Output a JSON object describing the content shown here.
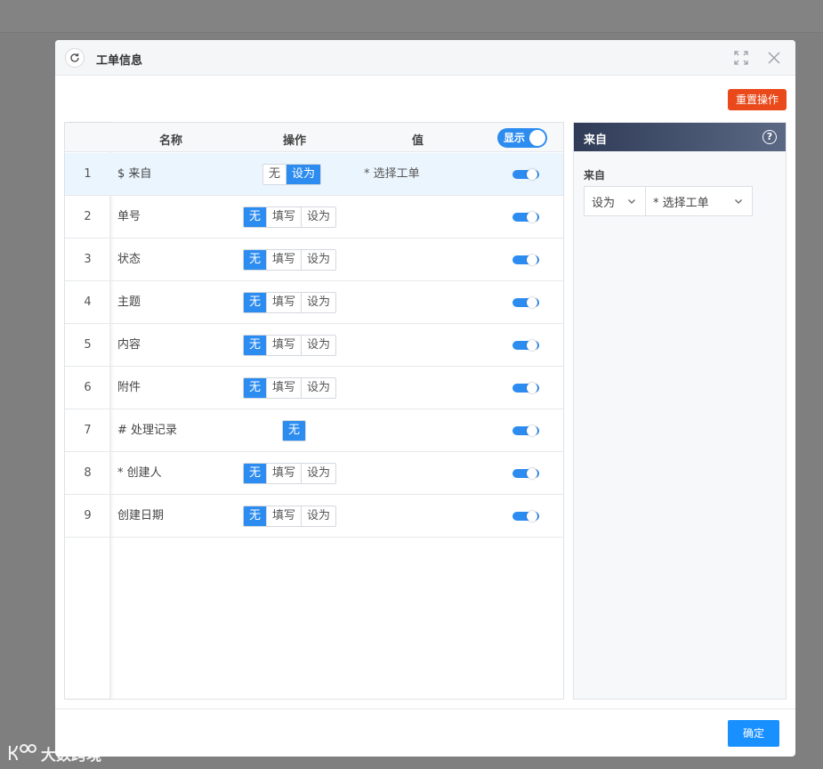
{
  "dialog": {
    "title": "工单信息",
    "reset_label": "重置操作",
    "ok_label": "确定"
  },
  "table": {
    "headers": {
      "name": "名称",
      "action": "操作",
      "value": "值"
    },
    "show_toggle_label": "显示",
    "rows": [
      {
        "index": "1",
        "name": "$ 来自",
        "options": [
          "无",
          "设为"
        ],
        "active": "设为",
        "value": "* 选择工单"
      },
      {
        "index": "2",
        "name": "单号",
        "options": [
          "无",
          "填写",
          "设为"
        ],
        "active": "无",
        "value": ""
      },
      {
        "index": "3",
        "name": "状态",
        "options": [
          "无",
          "填写",
          "设为"
        ],
        "active": "无",
        "value": ""
      },
      {
        "index": "4",
        "name": "主题",
        "options": [
          "无",
          "填写",
          "设为"
        ],
        "active": "无",
        "value": ""
      },
      {
        "index": "5",
        "name": "内容",
        "options": [
          "无",
          "填写",
          "设为"
        ],
        "active": "无",
        "value": ""
      },
      {
        "index": "6",
        "name": "附件",
        "options": [
          "无",
          "填写",
          "设为"
        ],
        "active": "无",
        "value": ""
      },
      {
        "index": "7",
        "name": "# 处理记录",
        "options": [
          "无"
        ],
        "active": "无",
        "value": ""
      },
      {
        "index": "8",
        "name": "* 创建人",
        "options": [
          "无",
          "填写",
          "设为"
        ],
        "active": "无",
        "value": ""
      },
      {
        "index": "9",
        "name": "创建日期",
        "options": [
          "无",
          "填写",
          "设为"
        ],
        "active": "无",
        "value": ""
      }
    ]
  },
  "side_panel": {
    "title": "来自",
    "field_label": "来自",
    "mode_select": "设为",
    "value_select": "* 选择工单"
  },
  "watermark": "大数跨境",
  "colors": {
    "accent": "#2d8cf0",
    "reset": "#ea4a1b",
    "ok": "#1890ff"
  }
}
